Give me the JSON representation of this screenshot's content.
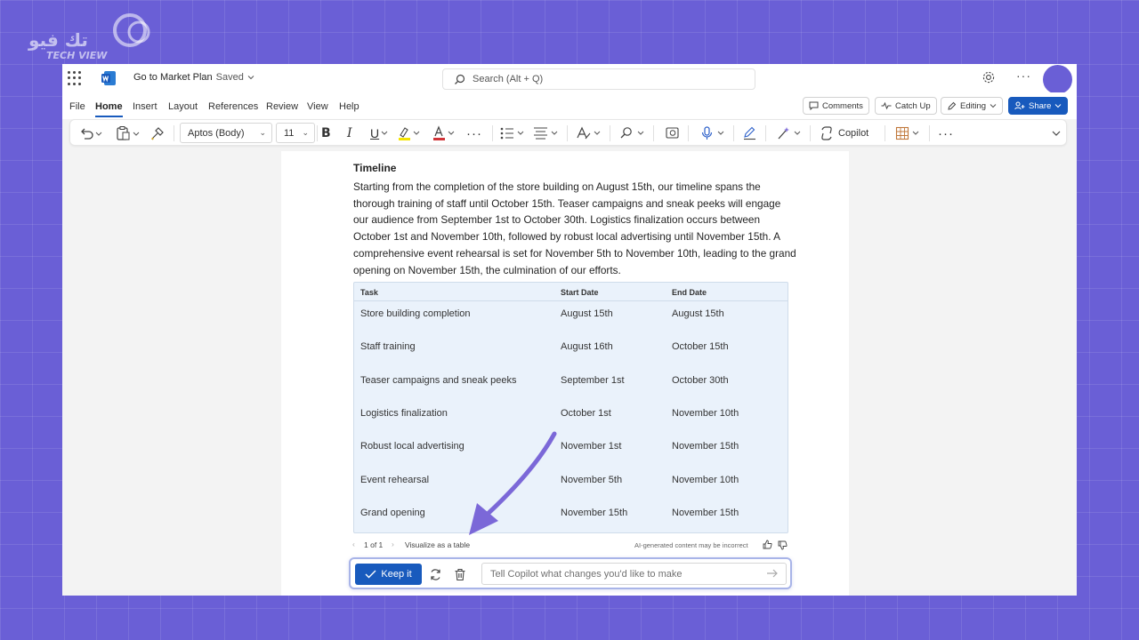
{
  "watermark": {
    "line1": "تك فيو",
    "line2": "TECH VIEW"
  },
  "titlebar": {
    "doc_title": "Go to Market Plan",
    "saved_status": "Saved",
    "search_placeholder": "Search (Alt + Q)"
  },
  "menu": {
    "items": [
      "File",
      "Home",
      "Insert",
      "Layout",
      "References",
      "Review",
      "View",
      "Help"
    ],
    "active": "Home",
    "comments": "Comments",
    "catch_up": "Catch Up",
    "editing": "Editing",
    "share": "Share"
  },
  "ribbon": {
    "font": "Aptos (Body)",
    "size": "11",
    "bold": "B",
    "italic": "I",
    "underline": "U",
    "copilot": "Copilot"
  },
  "document": {
    "heading": "Timeline",
    "paragraph": "Starting from the completion of the store building on August 15th, our timeline spans the thorough training of staff until October 15th. Teaser campaigns and sneak peeks will engage our audience from September 1st to October 30th. Logistics finalization occurs between October 1st and November 10th, followed by robust local advertising until November 15th. A comprehensive event rehearsal is set for November 5th to November 10th, leading to the grand opening on November 15th, the culmination of our efforts.",
    "table": {
      "headers": [
        "Task",
        "Start Date",
        "End Date"
      ],
      "rows": [
        [
          "Store building completion",
          "August 15th",
          "August 15th"
        ],
        [
          "Staff training",
          "August 16th",
          "October 15th"
        ],
        [
          "Teaser campaigns and sneak peeks",
          "September 1st",
          "October 30th"
        ],
        [
          "Logistics finalization",
          "October 1st",
          "November 10th"
        ],
        [
          "Robust local advertising",
          "November 1st",
          "November 15th"
        ],
        [
          "Event rehearsal",
          "November 5th",
          "November 10th"
        ],
        [
          "Grand opening",
          "November 15th",
          "November 15th"
        ]
      ]
    }
  },
  "copilot": {
    "pager": "1 of 1",
    "visualize": "Visualize as a table",
    "disclaimer": "AI-generated content may be incorrect",
    "keep": "Keep it",
    "prompt_placeholder": "Tell Copilot what changes you'd like to make"
  },
  "colors": {
    "accent": "#185abd",
    "background": "#6a5fd6",
    "annotation_arrow": "#7b68d8"
  }
}
